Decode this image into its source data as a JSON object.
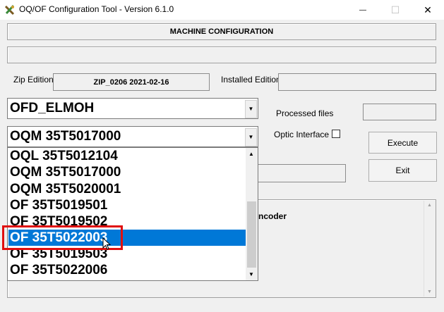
{
  "window": {
    "title": "OQ/OF Configuration Tool -  Version 6.1.0",
    "minimize_label": "—",
    "maximize_label": "☐",
    "close_label": "✕"
  },
  "header": {
    "machine_configuration_label": "MACHINE CONFIGURATION"
  },
  "zip": {
    "edition_label": "Zip Edition",
    "edition_value": "ZIP_0206 2021-02-16",
    "installed_label": "Installed Edition",
    "installed_value": ""
  },
  "machine_combo": {
    "value": "OFD_ELMOH"
  },
  "model_combo": {
    "value": "OQM 35T5017000",
    "options": [
      "OQL 35T5012104",
      "OQM 35T5017000",
      "OQM 35T5020001",
      "OF 35T5019501",
      "OF 35T5019502",
      "OF 35T5022003",
      "OF 35T5019503",
      "OF 35T5022006"
    ],
    "selected_option": "OF 35T5022003"
  },
  "processed_files": {
    "label": "Processed files",
    "value": ""
  },
  "optic_interface": {
    "label": "Optic Interface",
    "checked": false
  },
  "buttons": {
    "execute": "Execute",
    "exit": "Exit"
  },
  "encoder_text": "ncoder"
}
